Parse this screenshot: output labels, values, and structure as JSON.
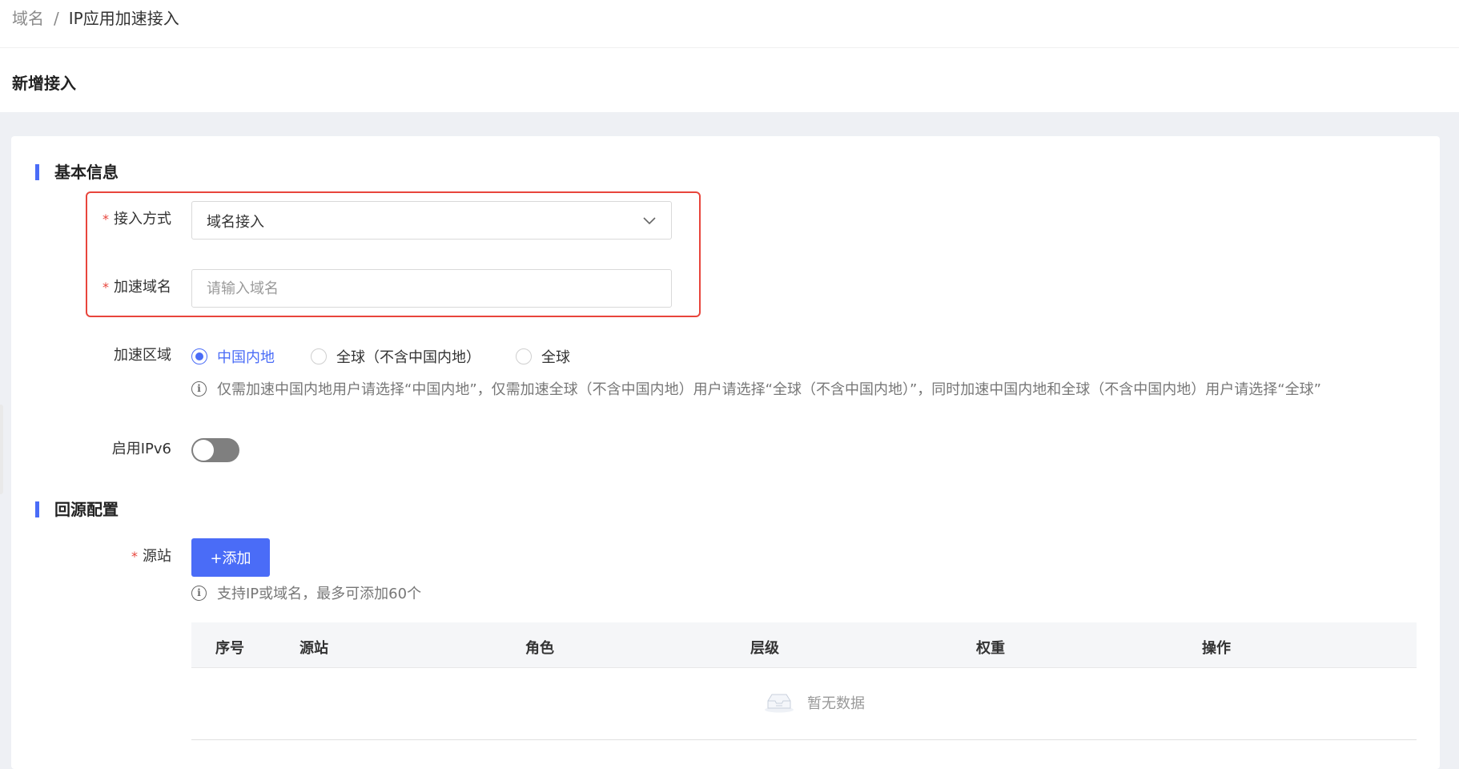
{
  "breadcrumb": {
    "parent": "域名",
    "separator": "/",
    "current": "IP应用加速接入"
  },
  "page_title": "新增接入",
  "basic_section": {
    "title": "基本信息",
    "access_method": {
      "label": "接入方式",
      "value": "域名接入"
    },
    "domain": {
      "label": "加速域名",
      "placeholder": "请输入域名",
      "value": ""
    },
    "region": {
      "label": "加速区域",
      "options": [
        "中国内地",
        "全球（不含中国内地）",
        "全球"
      ],
      "selected": "中国内地",
      "hint": "仅需加速中国内地用户请选择“中国内地”，仅需加速全球（不含中国内地）用户请选择“全球（不含中国内地）”，同时加速中国内地和全球（不含中国内地）用户请选择“全球”"
    },
    "ipv6": {
      "label": "启用IPv6",
      "enabled": false
    }
  },
  "origin_section": {
    "title": "回源配置",
    "origin": {
      "label": "源站",
      "add_button": "+添加",
      "hint": "支持IP或域名，最多可添加60个"
    },
    "table": {
      "columns": [
        "序号",
        "源站",
        "角色",
        "层级",
        "权重",
        "操作"
      ],
      "rows": [],
      "empty_text": "暂无数据"
    }
  },
  "colors": {
    "accent": "#4a6cf7",
    "required": "#e8453c",
    "highlight_border": "#e8453c"
  }
}
